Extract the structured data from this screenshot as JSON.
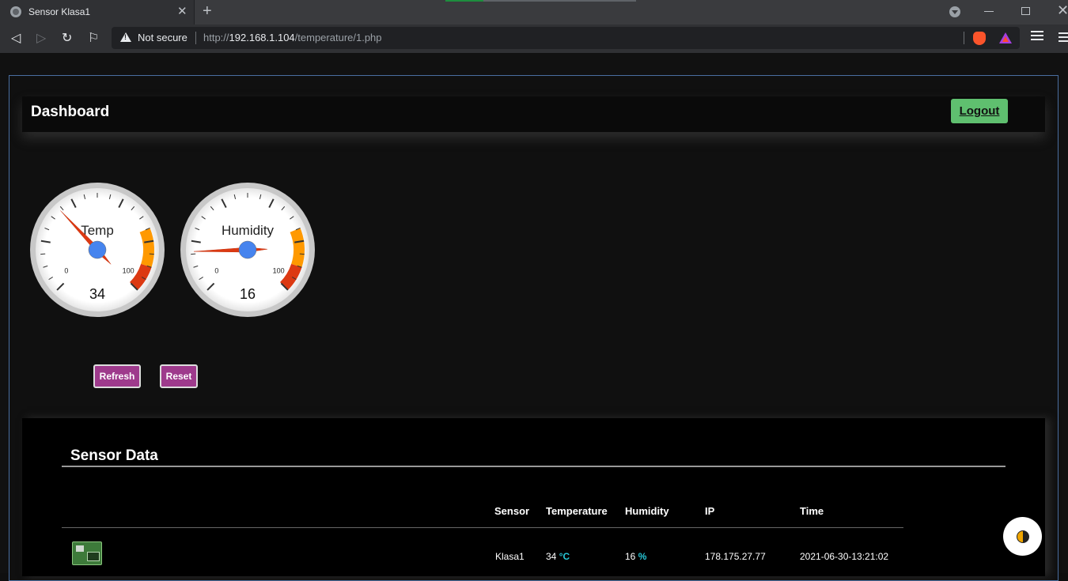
{
  "browser": {
    "tab_title": "Sensor Klasa1",
    "security_label": "Not secure",
    "url_scheme": "http://",
    "url_host": "192.168.1.104",
    "url_path": "/temperature/1.php"
  },
  "header": {
    "title": "Dashboard",
    "logout_label": "Logout"
  },
  "gauges": [
    {
      "label": "Temp",
      "value": 34,
      "display_value": "34",
      "min": 0,
      "max": 100,
      "min_label": "0",
      "max_label": "100"
    },
    {
      "label": "Humidity",
      "value": 16,
      "display_value": "16",
      "min": 0,
      "max": 100,
      "min_label": "0",
      "max_label": "100"
    }
  ],
  "gauge_colors": {
    "warning": "#ff9900",
    "danger": "#dc3912",
    "center": "#4684ee",
    "needle": "#dc3912"
  },
  "actions": {
    "refresh_label": "Refresh",
    "reset_label": "Reset"
  },
  "sensor_data": {
    "title": "Sensor Data",
    "columns": [
      "Sensor",
      "Temperature",
      "Humidity",
      "IP",
      "Time"
    ],
    "rows": [
      {
        "sensor": "Klasa1",
        "temperature": "34",
        "temperature_unit": "°C",
        "humidity": "16",
        "humidity_unit": "%",
        "ip": "178.175.27.77",
        "time": "2021-06-30-13:21:02"
      }
    ]
  },
  "colors": {
    "logout_bg": "#5fbf6f",
    "action_bg": "#9e3a8c",
    "unit_accent": "#27c8d8"
  }
}
